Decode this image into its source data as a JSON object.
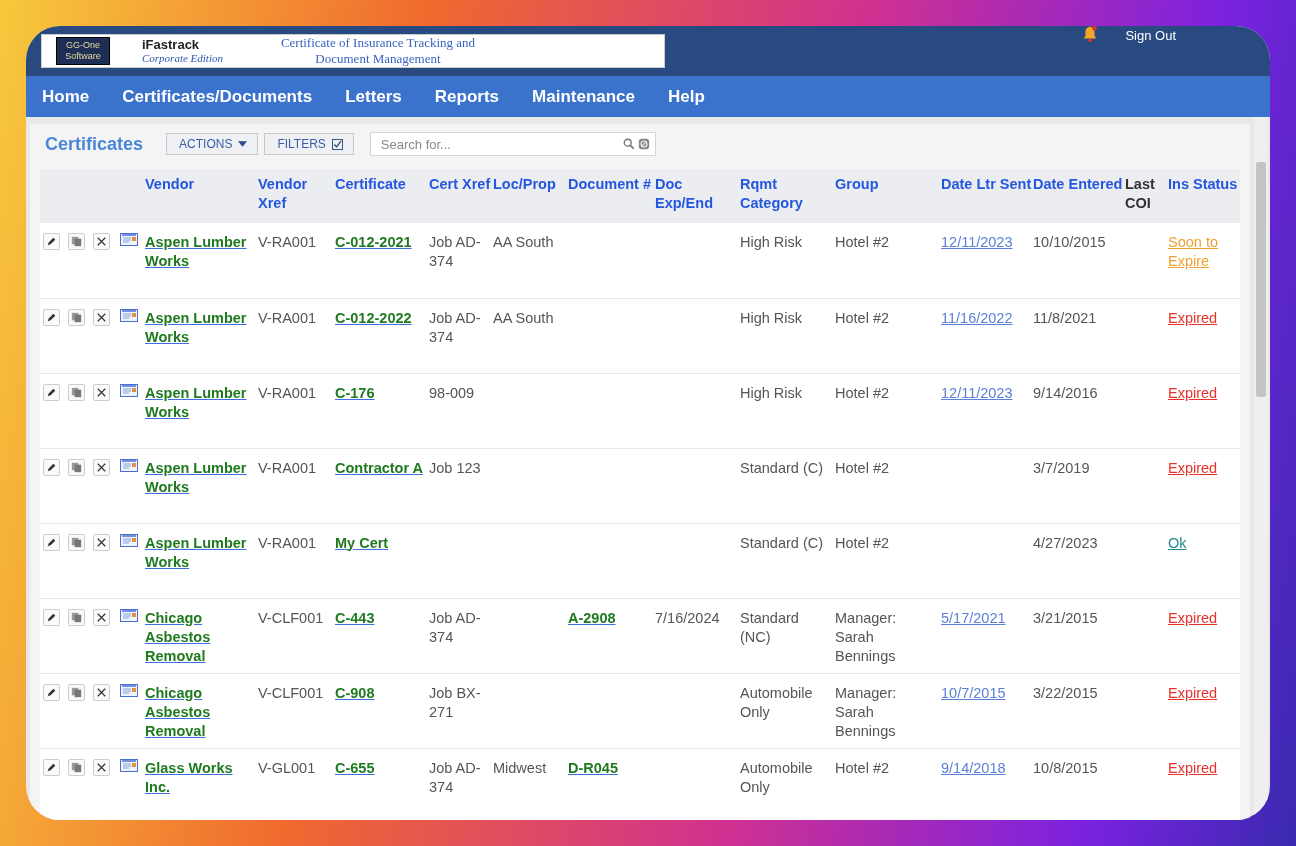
{
  "header": {
    "logo_text": "GG-One Software",
    "product": "iFastrack",
    "edition": "Corporate Edition",
    "tagline": "Certificate of Insurance Tracking and Document Management",
    "sign_out": "Sign Out"
  },
  "nav": [
    {
      "label": "Home"
    },
    {
      "label": "Certificates/Documents"
    },
    {
      "label": "Letters"
    },
    {
      "label": "Reports"
    },
    {
      "label": "Maintenance"
    },
    {
      "label": "Help"
    }
  ],
  "toolbar": {
    "title": "Certificates",
    "actions": "ACTIONS",
    "filters": "FILTERS",
    "filters_checked": true,
    "search": {
      "placeholder": "Search for..."
    }
  },
  "table": {
    "columns": [
      {
        "label": "Vendor",
        "kind": "link",
        "sortable": true
      },
      {
        "label": "Vendor Xref",
        "kind": "plain",
        "sortable": true
      },
      {
        "label": "Certificate",
        "kind": "link",
        "sortable": true
      },
      {
        "label": "Cert Xref",
        "kind": "plain",
        "sortable": true
      },
      {
        "label": "Loc/Prop",
        "kind": "plain",
        "sortable": true
      },
      {
        "label": "Document #",
        "kind": "link",
        "sortable": true
      },
      {
        "label": "Doc Exp/End",
        "kind": "plain",
        "sortable": true
      },
      {
        "label": "Rqmt Category",
        "kind": "plain",
        "sortable": true
      },
      {
        "label": "Group",
        "kind": "plain",
        "sortable": true
      },
      {
        "label": "Date Ltr Sent",
        "kind": "datelink",
        "sortable": true
      },
      {
        "label": "Date Entered",
        "kind": "plain",
        "sortable": true
      },
      {
        "label": "Last COI",
        "sortable": false
      },
      {
        "label": "Ins Status",
        "kind": "status",
        "sortable": true
      }
    ],
    "rows": [
      {
        "cells": [
          "Aspen Lumber Works",
          "V-RA001",
          "C-012-2021",
          "Job AD-374",
          "AA South",
          null,
          null,
          "High Risk",
          "Hotel #2",
          "12/11/2023",
          "10/10/2015",
          null,
          {
            "text": "Soon to Expire",
            "kind": "soon"
          }
        ]
      },
      {
        "cells": [
          "Aspen Lumber Works",
          "V-RA001",
          "C-012-2022",
          "Job AD-374",
          "AA South",
          null,
          null,
          "High Risk",
          "Hotel #2",
          "11/16/2022",
          "11/8/2021",
          null,
          {
            "text": "Expired",
            "kind": "expired"
          }
        ]
      },
      {
        "cells": [
          "Aspen Lumber Works",
          "V-RA001",
          "C-176",
          "98-009",
          null,
          null,
          null,
          "High Risk",
          "Hotel #2",
          "12/11/2023",
          "9/14/2016",
          null,
          {
            "text": "Expired",
            "kind": "expired"
          }
        ]
      },
      {
        "cells": [
          "Aspen Lumber Works",
          "V-RA001",
          "Contractor A",
          "Job 123",
          null,
          null,
          null,
          "Standard (C)",
          "Hotel #2",
          null,
          "3/7/2019",
          null,
          {
            "text": "Expired",
            "kind": "expired"
          }
        ]
      },
      {
        "cells": [
          "Aspen Lumber Works",
          "V-RA001",
          "My Cert",
          null,
          null,
          null,
          null,
          "Standard (C)",
          "Hotel #2",
          null,
          "4/27/2023",
          null,
          {
            "text": "Ok",
            "kind": "ok"
          }
        ]
      },
      {
        "cells": [
          "Chicago Asbestos Removal",
          "V-CLF001",
          "C-443",
          "Job AD-374",
          null,
          "A-2908",
          "7/16/2024",
          "Standard (NC)",
          "Manager: Sarah Bennings",
          "5/17/2021",
          "3/21/2015",
          null,
          {
            "text": "Expired",
            "kind": "expired"
          }
        ]
      },
      {
        "cells": [
          "Chicago Asbestos Removal",
          "V-CLF001",
          "C-908",
          "Job BX-271",
          null,
          null,
          null,
          "Automobile Only",
          "Manager: Sarah Bennings",
          "10/7/2015",
          "3/22/2015",
          null,
          {
            "text": "Expired",
            "kind": "expired"
          }
        ]
      },
      {
        "cells": [
          "Glass Works Inc.",
          "V-GL001",
          "C-655",
          "Job AD-374",
          "Midwest",
          "D-R045",
          null,
          "Automobile Only",
          "Hotel #2",
          "9/14/2018",
          "10/8/2015",
          null,
          {
            "text": "Expired",
            "kind": "expired"
          }
        ]
      }
    ]
  }
}
